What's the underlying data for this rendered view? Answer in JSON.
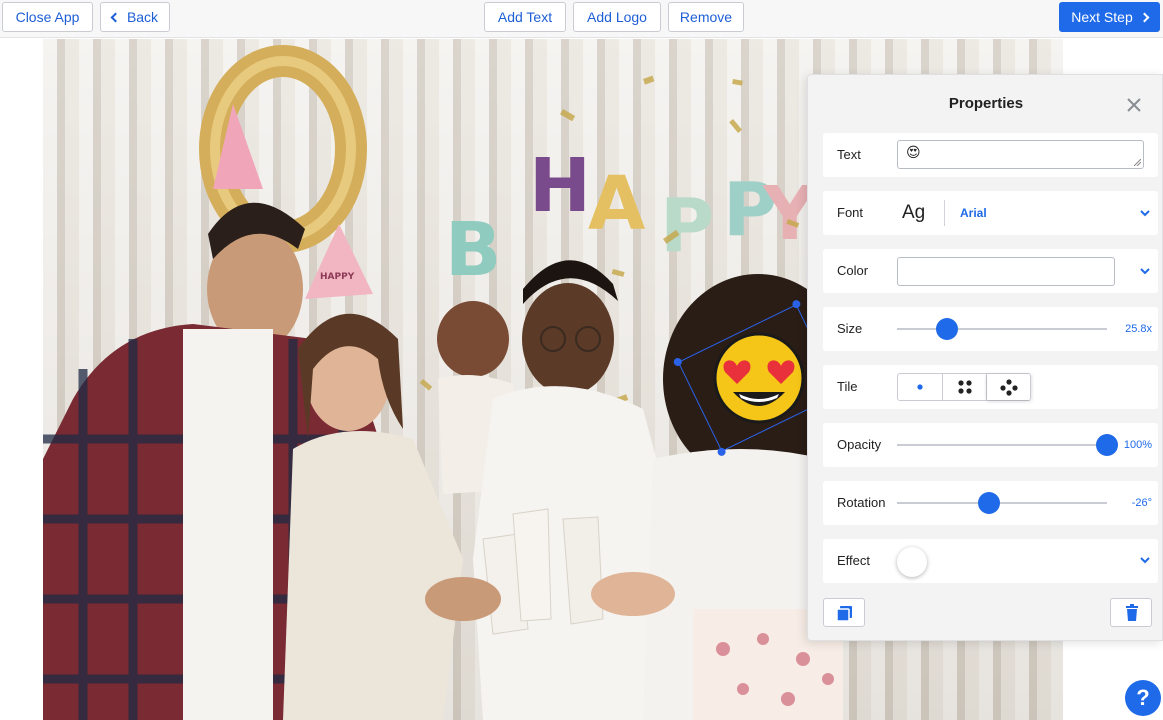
{
  "toolbar": {
    "close_app": "Close App",
    "back": "Back",
    "add_text": "Add Text",
    "add_logo": "Add Logo",
    "remove": "Remove",
    "next_step": "Next Step"
  },
  "photo": {
    "balloon_letters": [
      "H",
      "A",
      "P",
      "P",
      "Y"
    ],
    "balloon_letter_b": "B",
    "hat_text": "HAPPY"
  },
  "sticker": {
    "emoji": "😍",
    "rotation_deg": -26
  },
  "panel": {
    "title": "Properties",
    "text": {
      "label": "Text",
      "value": "😍"
    },
    "font": {
      "label": "Font",
      "sample": "Ag",
      "value": "Arial"
    },
    "color": {
      "label": "Color",
      "value": ""
    },
    "size": {
      "label": "Size",
      "value_text": "25.8x",
      "fraction": 0.24
    },
    "tile": {
      "label": "Tile",
      "options": [
        "single",
        "grid-4",
        "scatter"
      ],
      "selected": "scatter"
    },
    "opacity": {
      "label": "Opacity",
      "value_text": "100%",
      "fraction": 1.0
    },
    "rotation": {
      "label": "Rotation",
      "value_text": "-26°",
      "fraction": 0.44
    },
    "effect": {
      "label": "Effect"
    }
  },
  "help": {
    "label": "?"
  },
  "colors": {
    "accent": "#1f6ae8",
    "panel_bg": "#f3f3f4",
    "toolbar_bg": "#f7f7f8"
  }
}
